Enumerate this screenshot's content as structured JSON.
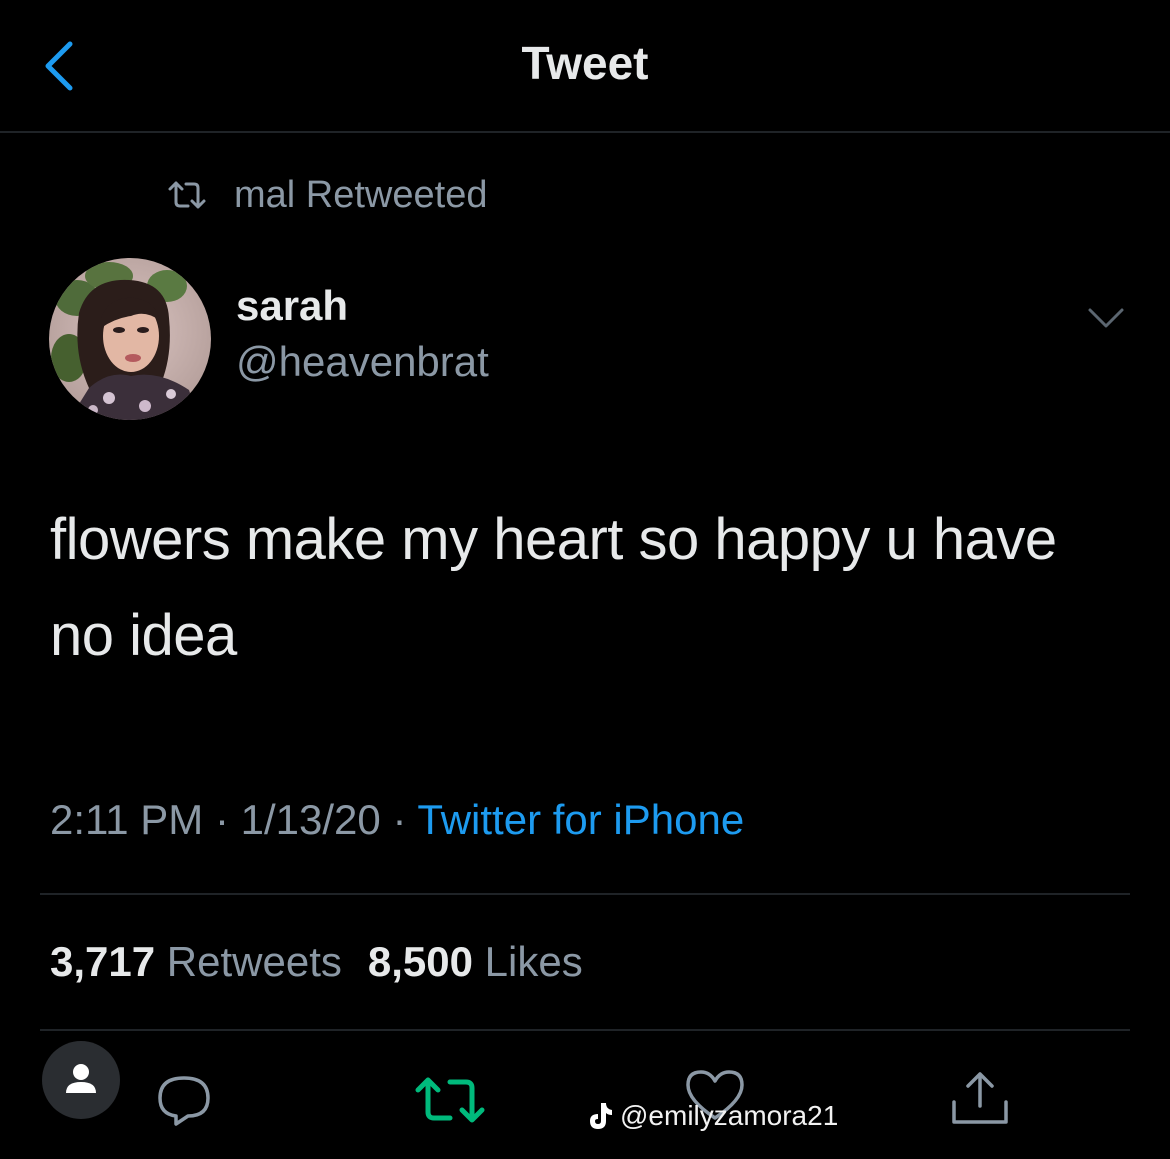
{
  "header": {
    "title": "Tweet",
    "back_icon": "chevron-left-icon"
  },
  "retweet_context": {
    "icon": "retweet-icon",
    "text": "mal Retweeted"
  },
  "author": {
    "name": "sarah",
    "handle": "@heavenbrat"
  },
  "tweet": {
    "text": "flowers make my heart so happy u have no idea",
    "time": "2:11 PM",
    "date": "1/13/20",
    "separator": "·",
    "source": "Twitter for iPhone"
  },
  "stats": {
    "retweets_count": "3,717",
    "retweets_label": "Retweets",
    "likes_count": "8,500",
    "likes_label": "Likes"
  },
  "actions": [
    "reply-icon",
    "retweet-icon",
    "like-icon",
    "share-icon"
  ],
  "watermark": {
    "icon": "tiktok-icon",
    "text": "@emilyzamora21"
  },
  "colors": {
    "background": "#000000",
    "text": "#e7e9ea",
    "secondary": "#8b98a5",
    "accent": "#1d9bf0",
    "retweet_active": "#00ba7c",
    "divider": "#1f2327"
  }
}
